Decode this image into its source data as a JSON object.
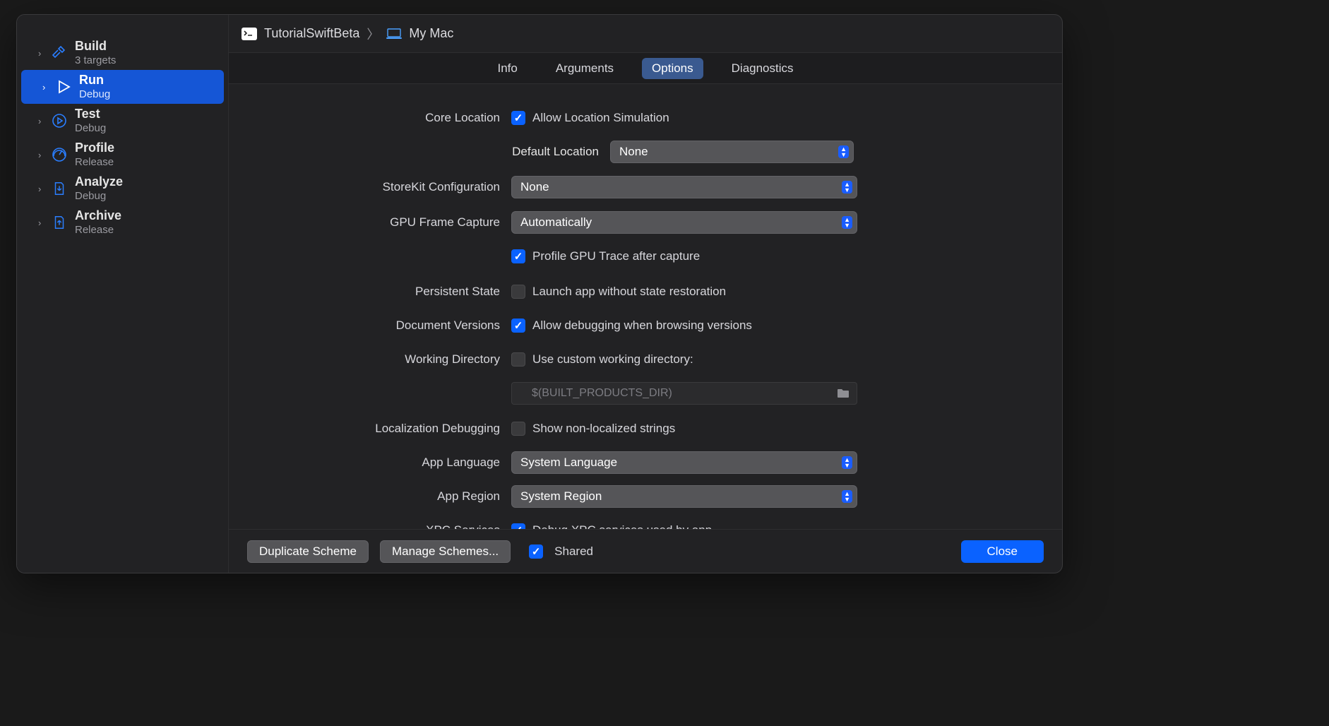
{
  "breadcrumbs": {
    "project": "TutorialSwiftBeta",
    "separator": "〉",
    "target": "My Mac"
  },
  "sidebar": {
    "items": [
      {
        "title": "Build",
        "sub": "3 targets",
        "icon": "hammer"
      },
      {
        "title": "Run",
        "sub": "Debug",
        "icon": "play",
        "selected": true
      },
      {
        "title": "Test",
        "sub": "Debug",
        "icon": "play-circle"
      },
      {
        "title": "Profile",
        "sub": "Release",
        "icon": "gauge"
      },
      {
        "title": "Analyze",
        "sub": "Debug",
        "icon": "doc-arrow"
      },
      {
        "title": "Archive",
        "sub": "Release",
        "icon": "doc-up"
      }
    ]
  },
  "tabs": {
    "items": [
      "Info",
      "Arguments",
      "Options",
      "Diagnostics"
    ],
    "active": 2
  },
  "options": {
    "core_location": {
      "label": "Core Location",
      "allow_label": "Allow Location Simulation",
      "allow_checked": true,
      "default_label": "Default Location",
      "default_value": "None"
    },
    "storekit": {
      "label": "StoreKit Configuration",
      "value": "None"
    },
    "gpu": {
      "label": "GPU Frame Capture",
      "value": "Automatically",
      "profile_label": "Profile GPU Trace after capture",
      "profile_checked": true
    },
    "persistent": {
      "label": "Persistent State",
      "check_label": "Launch app without state restoration",
      "checked": false
    },
    "docver": {
      "label": "Document Versions",
      "check_label": "Allow debugging when browsing versions",
      "checked": true
    },
    "workdir": {
      "label": "Working Directory",
      "check_label": "Use custom working directory:",
      "checked": false,
      "path_placeholder": "$(BUILT_PRODUCTS_DIR)"
    },
    "locdebug": {
      "label": "Localization Debugging",
      "check_label": "Show non-localized strings",
      "checked": false
    },
    "applang": {
      "label": "App Language",
      "value": "System Language"
    },
    "appregion": {
      "label": "App Region",
      "value": "System Region"
    },
    "xpc": {
      "label": "XPC Services",
      "check_label": "Debug XPC services used by app",
      "checked": true
    }
  },
  "footer": {
    "duplicate": "Duplicate Scheme",
    "manage": "Manage Schemes...",
    "shared_label": "Shared",
    "shared_checked": true,
    "close": "Close"
  }
}
